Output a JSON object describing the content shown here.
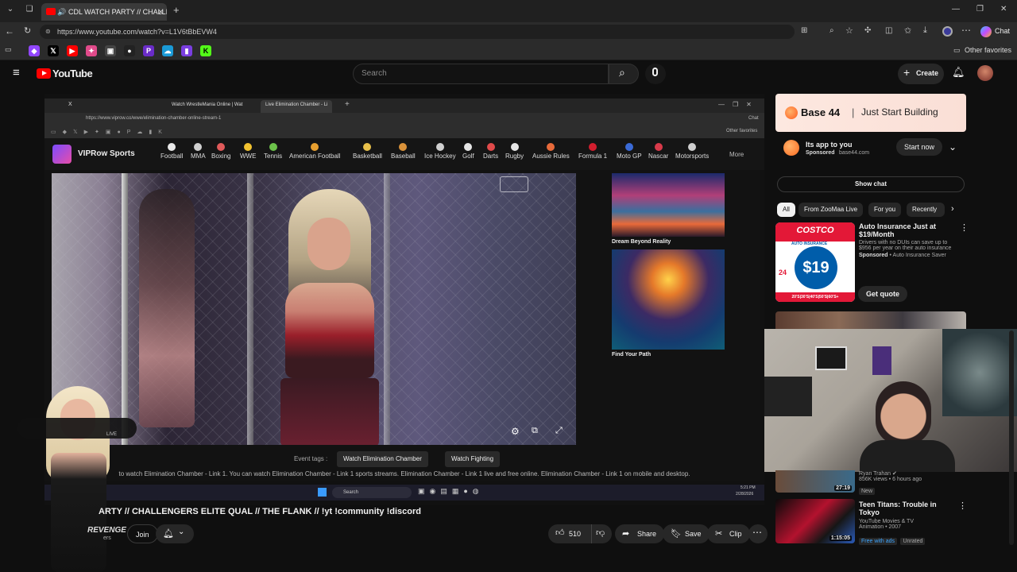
{
  "browser": {
    "tab_title": "CDL WATCH PARTY // CHALLE",
    "url": "https://www.youtube.com/watch?v=L1V6tBbEVW4",
    "other_favorites": "Other favorites",
    "chat_label": "Chat"
  },
  "youtube": {
    "logo_text": "YouTube",
    "search_placeholder": "Search",
    "create_label": "Create",
    "video_title": "ARTY // CHALLENGERS ELITE QUAL // THE FLANK // !yt !community !discord",
    "join_label": "Join",
    "subscribers_fragment": "ers",
    "likes": "510",
    "share_label": "Share",
    "save_label": "Save",
    "clip_label": "Clip"
  },
  "embedded": {
    "tabs": [
      "X",
      "Watch WrestleMania Online | Wat",
      "Live Elimination Chamber - Li"
    ],
    "url": "https://www.viprow.co/wwe/elimination-chamber-online-stream-1",
    "other_favorites": "Other favorites",
    "site_name": "VIPRow Sports",
    "nav": [
      "Football",
      "MMA",
      "Boxing",
      "WWE",
      "Tennis",
      "American Football",
      "Basketball",
      "Baseball",
      "Ice Hockey",
      "Golf",
      "Darts",
      "Rugby",
      "Aussie Rules",
      "Formula 1",
      "Moto GP",
      "Nascar",
      "Motorsports"
    ],
    "more_label": "More",
    "thumbs": [
      "Dream Beyond Reality",
      "Find Your Path"
    ],
    "event_tags_label": "Event tags :",
    "tags": [
      "Watch Elimination Chamber",
      "Watch Fighting"
    ],
    "description": "to watch Elimination Chamber - Link 1. You can watch Elimination Chamber - Link 1 sports streams. Elimination Chamber - Link 1 live and free online. Elimination Chamber - Link 1 on mobile and desktop.",
    "taskbar_search": "Search",
    "clock_time": "5:21 PM",
    "clock_date": "2/28/2026",
    "player_live": "LIVE",
    "overlay_text": "REVENGE"
  },
  "sidebar": {
    "ad_headline": "Base 44  |  Just Start Building",
    "ad_brand": "Base 44",
    "ad_tagline": "Just Start Building",
    "ad_title": "Its app to you",
    "ad_sponsored": "Sponsored",
    "ad_domain": "base44.com",
    "ad_cta": "Start now",
    "show_chat": "Show chat",
    "chips": [
      "All",
      "From ZooMaa Live",
      "For you",
      "Recently"
    ],
    "costco": {
      "title": "Auto Insurance Just at $19/Month",
      "desc": "Drivers with no DUIs can save up to $956 per year on their auto insurance",
      "sponsored": "Sponsored",
      "advertiser": "Auto Insurance Saver",
      "cta": "Get quote",
      "logo": "COSTCO",
      "logo_sub": "AUTO INSURANCE",
      "price": "$19",
      "price_small": "24",
      "ages": "20'S|30'S|40'S|50'S|60'S+"
    },
    "rec1": {
      "channel": "Ryan Trahan",
      "meta": "856K views • 6 hours ago",
      "badge": "New",
      "duration": "27:19"
    },
    "rec2": {
      "title": "Teen Titans: Trouble in Tokyo",
      "channel": "YouTube Movies & TV",
      "meta": "Animation • 2007",
      "badge_a": "Free with ads",
      "badge_b": "Unrated",
      "duration": "1:15:05"
    }
  },
  "colors": {
    "yt_red": "#ff0000",
    "bg": "#0f0f0f",
    "chip_active": "#f1f1f1",
    "costco_red": "#e31837",
    "costco_blue": "#005daa"
  }
}
